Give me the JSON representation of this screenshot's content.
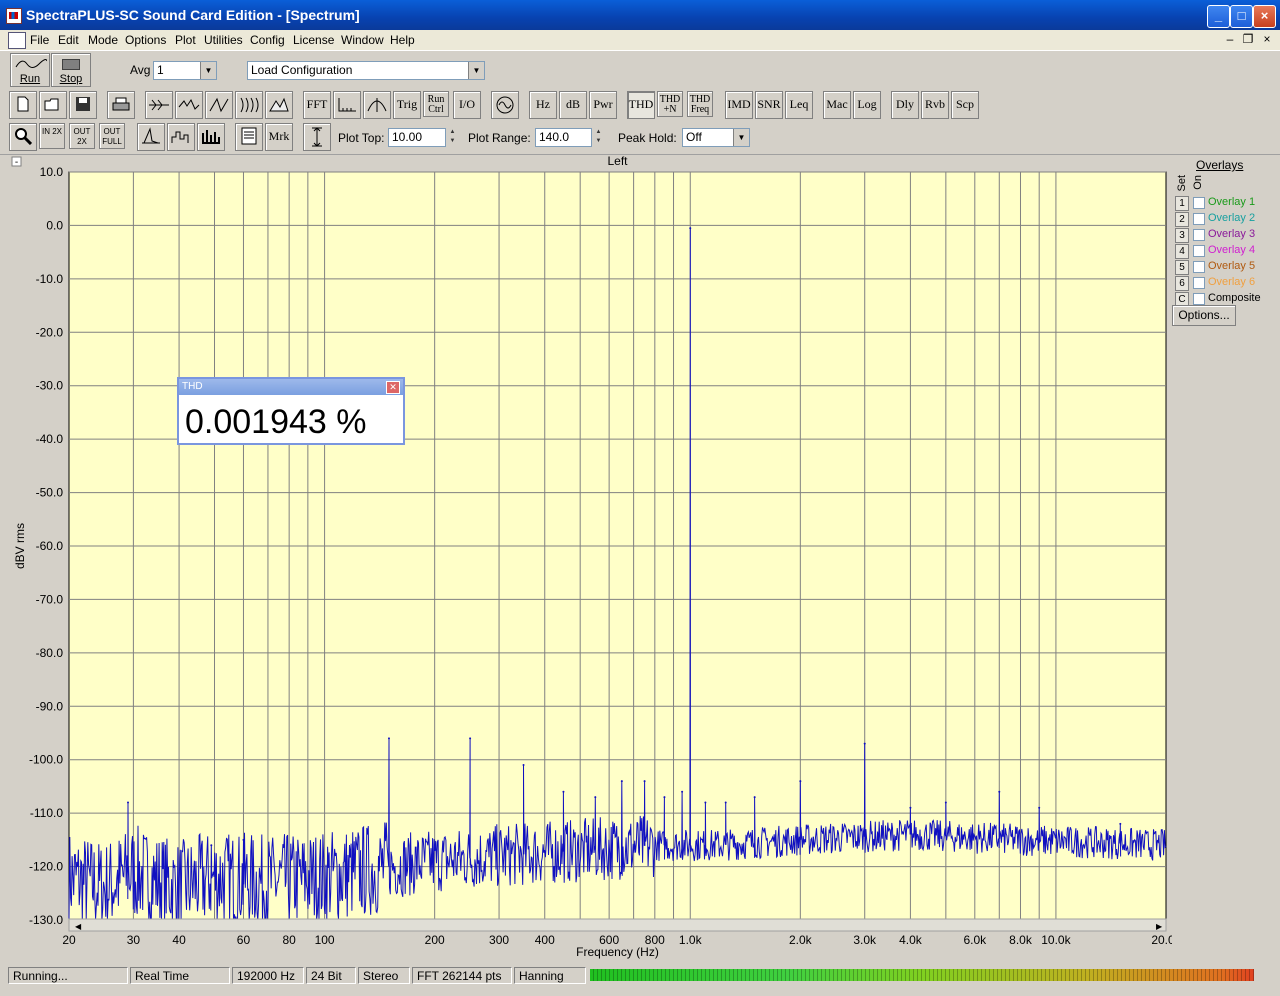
{
  "window": {
    "title": "SpectraPLUS-SC Sound Card Edition - [Spectrum]",
    "controls": [
      "_",
      "□",
      "×"
    ]
  },
  "menu": [
    "File",
    "Edit",
    "Mode",
    "Options",
    "Plot",
    "Utilities",
    "Config",
    "License",
    "Window",
    "Help"
  ],
  "mdi_controls": [
    "–",
    "❐",
    "×"
  ],
  "toolbar1": {
    "run_label": "Run",
    "stop_label": "Stop",
    "avg_label": "Avg",
    "avg_value": "1",
    "config_value": "Load Configuration"
  },
  "toolbar2": {
    "buttons": [
      "FFT",
      "Trig",
      "Run Ctrl",
      "I/O",
      "Hz",
      "dB",
      "Pwr",
      "THD",
      "THD +N",
      "THD Freq",
      "IMD",
      "SNR",
      "Leq",
      "Mac",
      "Log",
      "Dly",
      "Rvb",
      "Scp"
    ]
  },
  "toolbar3": {
    "mrk": "Mrk",
    "zoom_in": "IN 2X",
    "zoom_out": "OUT 2X",
    "zoom_full": "OUT FULL",
    "plot_top_label": "Plot Top:",
    "plot_top_value": "10.00",
    "plot_range_label": "Plot Range:",
    "plot_range_value": "140.0",
    "peak_hold_label": "Peak Hold:",
    "peak_hold_value": "Off"
  },
  "plot": {
    "channel": "Left",
    "collapse": "-",
    "expand": "+"
  },
  "overlays": {
    "title": "Overlays",
    "set_label": "Set",
    "on_label": "On",
    "items": [
      {
        "num": "1",
        "name": "Overlay 1",
        "color": "#1a9a1a"
      },
      {
        "num": "2",
        "name": "Overlay 2",
        "color": "#18a0a0"
      },
      {
        "num": "3",
        "name": "Overlay 3",
        "color": "#8a1a9a"
      },
      {
        "num": "4",
        "name": "Overlay 4",
        "color": "#d020d0"
      },
      {
        "num": "5",
        "name": "Overlay 5",
        "color": "#b05a10"
      },
      {
        "num": "6",
        "name": "Overlay 6",
        "color": "#f0a040"
      },
      {
        "num": "C",
        "name": "Composite",
        "color": "#000000"
      }
    ],
    "options_label": "Options..."
  },
  "thd_window": {
    "title": "THD",
    "value": "0.001943 %"
  },
  "status": {
    "items": [
      "Running...",
      "Real Time",
      "192000 Hz",
      "24 Bit",
      "Stereo",
      "FFT 262144 pts",
      "Hanning"
    ]
  },
  "chart_data": {
    "type": "line",
    "title": "Left",
    "xlabel": "Frequency (Hz)",
    "ylabel": "dBV rms",
    "xscale": "log",
    "xlim": [
      20,
      20000
    ],
    "ylim": [
      -130,
      10
    ],
    "plot_bg": "#ffffc8",
    "line_color": "#1010c0",
    "grid": true,
    "x_tick_values": [
      20,
      30,
      40,
      60,
      80,
      100,
      200,
      300,
      400,
      600,
      800,
      1000,
      2000,
      3000,
      4000,
      6000,
      8000,
      10000,
      20000
    ],
    "x_tick_labels": [
      "20",
      "30",
      "40",
      "60",
      "80",
      "100",
      "200",
      "300",
      "400",
      "600",
      "800",
      "1.0k",
      "2.0k",
      "3.0k",
      "4.0k",
      "6.0k",
      "8.0k",
      "10.0k",
      "20.0k"
    ],
    "y_tick_values": [
      10,
      0,
      -10,
      -20,
      -30,
      -40,
      -50,
      -60,
      -70,
      -80,
      -90,
      -100,
      -110,
      -120,
      -130
    ],
    "y_tick_labels": [
      "10.0",
      "0.0",
      "-10.0",
      "-20.0",
      "-30.0",
      "-40.0",
      "-50.0",
      "-60.0",
      "-70.0",
      "-80.0",
      "-90.0",
      "-100.0",
      "-110.0",
      "-120.0",
      "-130.0"
    ],
    "noise_floor": [
      [
        20,
        -122
      ],
      [
        25,
        -124
      ],
      [
        30,
        -121
      ],
      [
        40,
        -124
      ],
      [
        50,
        -122
      ],
      [
        70,
        -123
      ],
      [
        100,
        -122
      ],
      [
        150,
        -120
      ],
      [
        200,
        -119
      ],
      [
        300,
        -118
      ],
      [
        500,
        -117
      ],
      [
        800,
        -116
      ],
      [
        1200,
        -116
      ],
      [
        2000,
        -115
      ],
      [
        4000,
        -114
      ],
      [
        8000,
        -115
      ],
      [
        20000,
        -116
      ]
    ],
    "peaks": [
      [
        29,
        -108
      ],
      [
        49,
        -116
      ],
      [
        60,
        -115
      ],
      [
        150,
        -96
      ],
      [
        250,
        -96
      ],
      [
        350,
        -101
      ],
      [
        450,
        -106
      ],
      [
        550,
        -107
      ],
      [
        650,
        -104
      ],
      [
        750,
        -104
      ],
      [
        850,
        -107
      ],
      [
        950,
        -106
      ],
      [
        1000,
        -0.5
      ],
      [
        1100,
        -108
      ],
      [
        1250,
        -108
      ],
      [
        1500,
        -107
      ],
      [
        2000,
        -104
      ],
      [
        3000,
        -97
      ],
      [
        4000,
        -109
      ],
      [
        5000,
        -108
      ],
      [
        7000,
        -106
      ],
      [
        9000,
        -109
      ],
      [
        15000,
        -112
      ]
    ]
  }
}
